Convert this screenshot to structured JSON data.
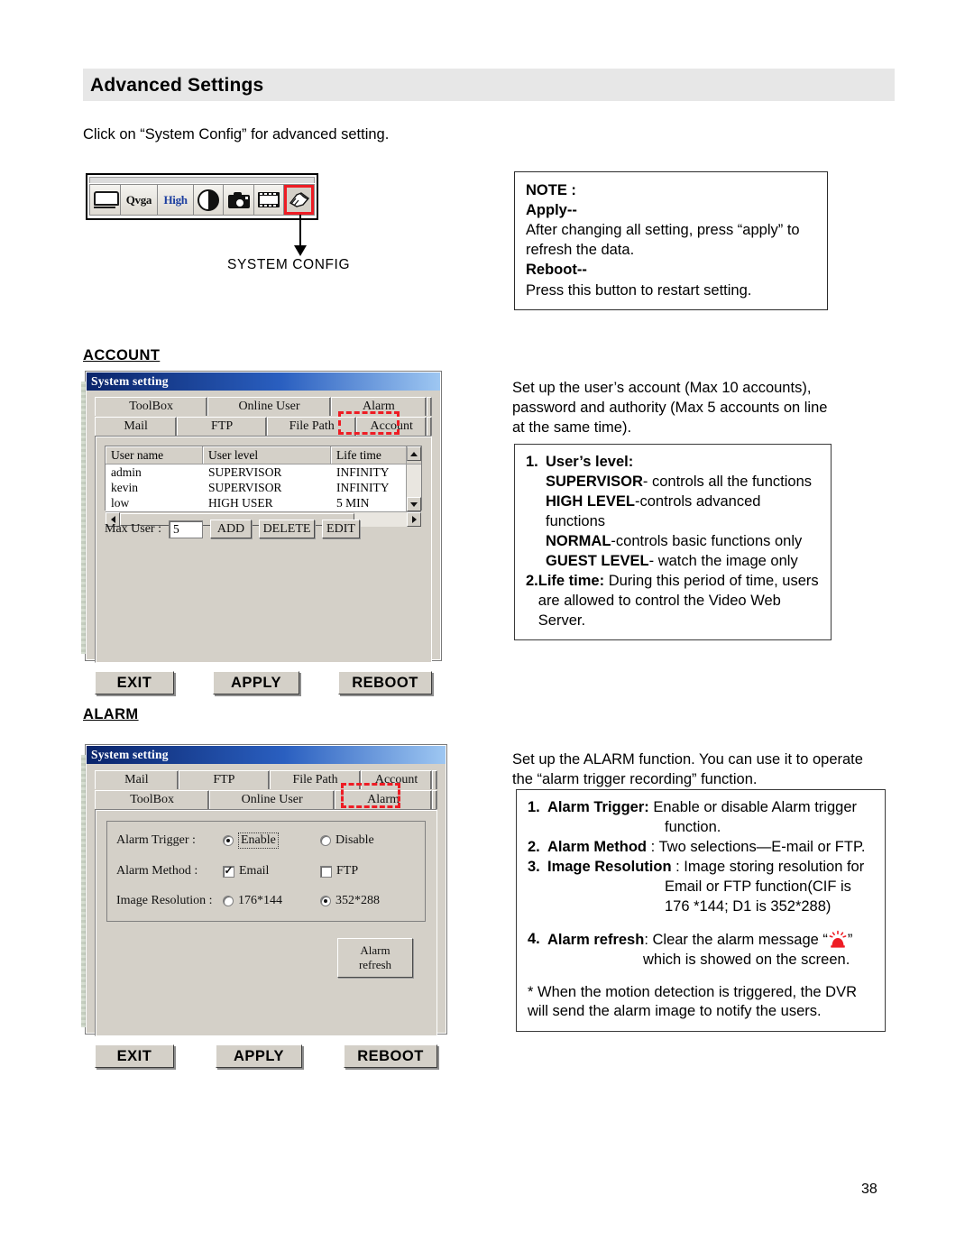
{
  "page": {
    "title": "Advanced Settings",
    "intro": "Click on “System Config” for advanced setting.",
    "number": "38",
    "banner_color": "#e7e7e7",
    "accent_red": "#ee1c24"
  },
  "toolbar": {
    "caption": "SYSTEM CONFIG",
    "buttons": [
      {
        "name": "monitor-icon",
        "label": ""
      },
      {
        "name": "qvga-button",
        "label": "Qvga"
      },
      {
        "name": "high-button",
        "label": "High"
      },
      {
        "name": "contrast-icon",
        "label": ""
      },
      {
        "name": "camera-icon",
        "label": ""
      },
      {
        "name": "film-icon",
        "label": ""
      },
      {
        "name": "system-config-icon",
        "label": ""
      }
    ],
    "selected": "system-config-icon"
  },
  "note": {
    "heading": "NOTE :",
    "apply_label": "Apply--",
    "apply_text": "After changing all setting, press “apply” to refresh the data.",
    "reboot_label": "Reboot--",
    "reboot_text": "Press this button to restart setting."
  },
  "sections": {
    "account_heading": "ACCOUNT",
    "alarm_heading": "ALARM"
  },
  "account_dialog": {
    "window_title": "System setting",
    "tabs_top": [
      "ToolBox",
      "Online User",
      "Alarm"
    ],
    "tabs_bottom": [
      "Mail",
      "FTP",
      "File Path",
      "Account"
    ],
    "active_tab": "Account",
    "list_headers": [
      "User name",
      "User level",
      "Life time"
    ],
    "list_rows": [
      {
        "user_name": "admin",
        "user_level": "SUPERVISOR",
        "life_time": "INFINITY"
      },
      {
        "user_name": "kevin",
        "user_level": "SUPERVISOR",
        "life_time": "INFINITY"
      },
      {
        "user_name": "low",
        "user_level": "HIGH USER",
        "life_time": "5 MIN"
      }
    ],
    "max_user_label": "Max User :",
    "max_user_value": "5",
    "buttons": [
      "ADD",
      "DELETE",
      "EDIT"
    ],
    "footer_buttons": [
      "EXIT",
      "APPLY",
      "REBOOT"
    ]
  },
  "account_text": {
    "intro": "Set up the user’s account (Max 10 accounts), password and authority (Max 5 accounts on line at the same time).",
    "item1_num": "1.",
    "item1_label": "User’s level:",
    "level_supervisor_b": "SUPERVISOR",
    "level_supervisor_t": "- controls all the functions",
    "level_high_b": "HIGH LEVEL",
    "level_high_t": "-controls advanced functions",
    "level_normal_b": "NORMAL",
    "level_normal_t": "-controls basic functions only",
    "level_guest_b": "GUEST LEVEL",
    "level_guest_t": "- watch the image only",
    "item2_num": "2.",
    "item2_label": "Life time:",
    "item2_text": "During this period of time, users are allowed to control the Video Web Server."
  },
  "alarm_dialog": {
    "window_title": "System setting",
    "tabs_top": [
      "Mail",
      "FTP",
      "File Path",
      "Account"
    ],
    "tabs_bottom": [
      "ToolBox",
      "Online User",
      "Alarm"
    ],
    "active_tab": "Alarm",
    "fields": [
      {
        "label": "Alarm Trigger :",
        "type": "radio",
        "options": [
          {
            "text": "Enable",
            "selected": true,
            "focused": true
          },
          {
            "text": "Disable",
            "selected": false,
            "focused": false
          }
        ]
      },
      {
        "label": "Alarm Method :",
        "type": "checkbox",
        "options": [
          {
            "text": "Email",
            "checked": true
          },
          {
            "text": "FTP",
            "checked": false
          }
        ]
      },
      {
        "label": "Image Resolution :",
        "type": "radio",
        "options": [
          {
            "text": "176*144",
            "selected": false,
            "focused": false
          },
          {
            "text": "352*288",
            "selected": true,
            "focused": false
          }
        ]
      }
    ],
    "alarm_refresh_line1": "Alarm",
    "alarm_refresh_line2": "refresh",
    "footer_buttons": [
      "EXIT",
      "APPLY",
      "REBOOT"
    ]
  },
  "alarm_text": {
    "intro": "Set up the ALARM function. You can use it to operate the “alarm trigger recording” function.",
    "item1_num": "1.",
    "item1_label": "Alarm Trigger:",
    "item1_text": "Enable or disable Alarm trigger",
    "item1_text_cont": "function.",
    "item2_num": "2.",
    "item2_label": "Alarm Method",
    "item2_text": ": Two selections—E-mail or FTP.",
    "item3_num": "3.",
    "item3_label": "Image Resolution",
    "item3_text": ": Image storing resolution for",
    "item3_text_cont1": "Email or FTP function(CIF is",
    "item3_text_cont2": "176 *144; D1 is 352*288)",
    "item4_num": "4.",
    "item4_label": "Alarm refresh",
    "item4_text_a": ": Clear the alarm message “",
    "item4_icon": "siren-icon",
    "item4_text_b": "”",
    "item4_text_cont": "which is showed on the screen.",
    "footnote": "* When the motion detection is triggered, the DVR will send the alarm image to notify the users."
  }
}
